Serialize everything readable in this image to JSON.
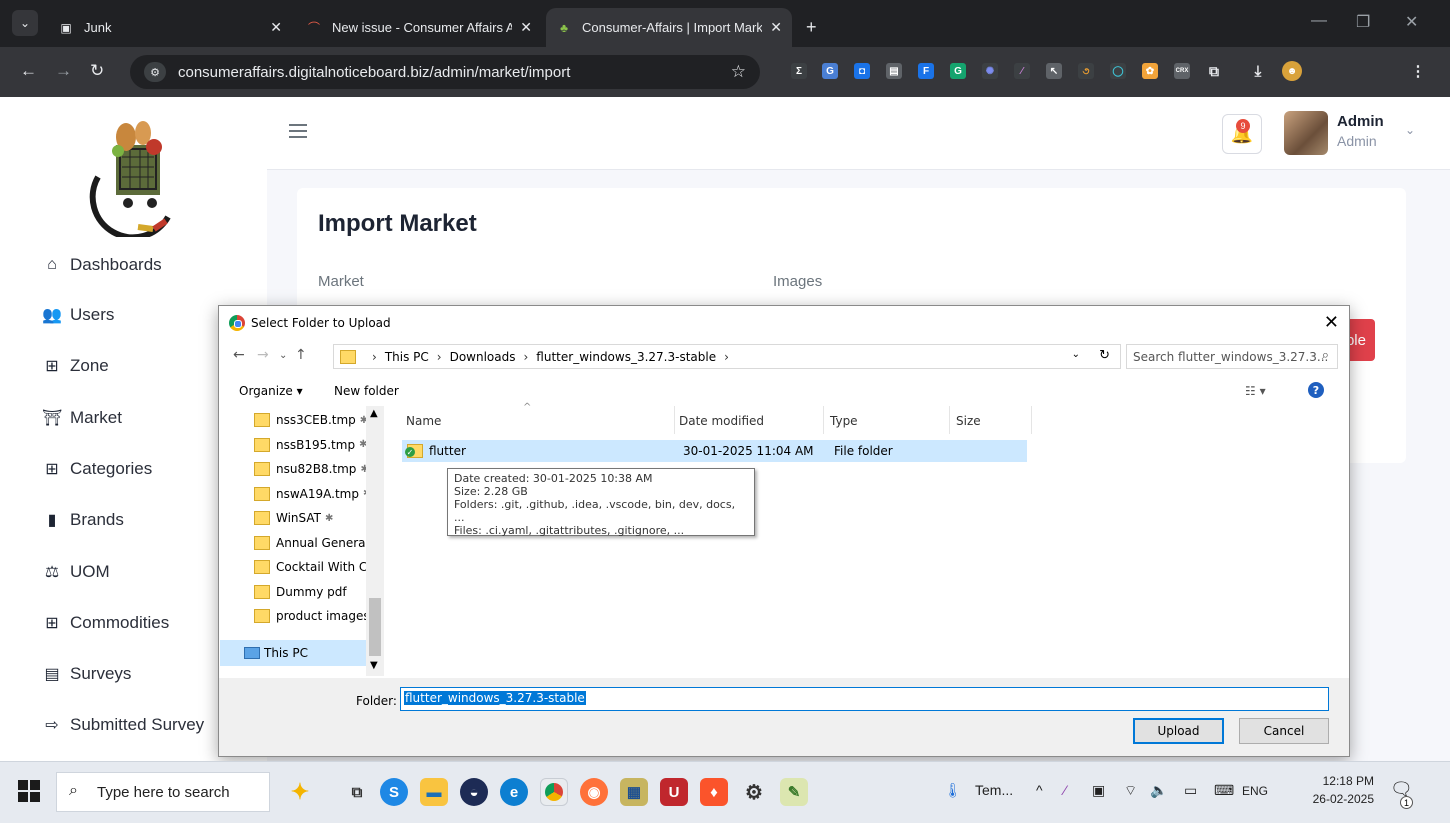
{
  "browser": {
    "tabs": [
      {
        "title": "Junk",
        "icon": "work-profile-icon"
      },
      {
        "title": "New issue - Consumer Affairs A",
        "icon": "tracker-icon"
      },
      {
        "title": "Consumer-Affairs | Import Mark",
        "icon": "site-favicon",
        "active": true
      }
    ],
    "new_tab": "+",
    "url": "consumeraffairs.digitalnoticeboard.biz/admin/market/import"
  },
  "app": {
    "sidebar": {
      "items": [
        {
          "label": "Dashboards",
          "icon": "home-icon"
        },
        {
          "label": "Users",
          "icon": "users-icon"
        },
        {
          "label": "Zone",
          "icon": "grid-icon"
        },
        {
          "label": "Market",
          "icon": "store-icon"
        },
        {
          "label": "Categories",
          "icon": "grid-icon"
        },
        {
          "label": "Brands",
          "icon": "badge-icon"
        },
        {
          "label": "UOM",
          "icon": "scale-icon"
        },
        {
          "label": "Commodities",
          "icon": "grid-icon"
        },
        {
          "label": "Surveys",
          "icon": "survey-icon"
        },
        {
          "label": "Submitted Survey",
          "icon": "submit-icon"
        }
      ]
    },
    "header": {
      "notification_count": "9",
      "user_name": "Admin",
      "user_role": "Admin"
    },
    "card": {
      "title": "Import Market",
      "market_label": "Market",
      "images_label": "Images",
      "sample_button": "ple"
    }
  },
  "dialog": {
    "title": "Select Folder to Upload",
    "path": [
      "This PC",
      "Downloads",
      "flutter_windows_3.27.3-stable"
    ],
    "search_placeholder": "Search flutter_windows_3.27.3...",
    "organize": "Organize ▾",
    "new_folder": "New folder",
    "nav_items": [
      {
        "label": "nss3CEB.tmp",
        "pinned": true
      },
      {
        "label": "nssB195.tmp",
        "pinned": true
      },
      {
        "label": "nsu82B8.tmp",
        "pinned": true
      },
      {
        "label": "nswA19A.tmp",
        "pinned": true
      },
      {
        "label": "WinSAT",
        "pinned": true
      },
      {
        "label": "Annual General M",
        "pinned": false
      },
      {
        "label": "Cocktail With Co",
        "pinned": false
      },
      {
        "label": "Dummy pdf",
        "pinned": false
      },
      {
        "label": "product images",
        "pinned": false
      }
    ],
    "this_pc": "This PC",
    "columns": [
      "Name",
      "Date modified",
      "Type",
      "Size"
    ],
    "files": [
      {
        "name": "flutter",
        "modified": "30-01-2025 11:04 AM",
        "type": "File folder",
        "size": ""
      }
    ],
    "tooltip": [
      "Date created: 30-01-2025 10:38 AM",
      "Size: 2.28 GB",
      "Folders: .git, .github, .idea, .vscode, bin, dev, docs, ...",
      "Files: .ci.yaml, .gitattributes, .gitignore, ..."
    ],
    "folder_label": "Folder:",
    "folder_value": "flutter_windows_3.27.3-stable",
    "upload": "Upload",
    "cancel": "Cancel"
  },
  "taskbar": {
    "search_placeholder": "Type here to search",
    "weather": "Tem...",
    "language": "ENG",
    "time": "12:18 PM",
    "date": "26-02-2025",
    "notification_badge": "1"
  }
}
